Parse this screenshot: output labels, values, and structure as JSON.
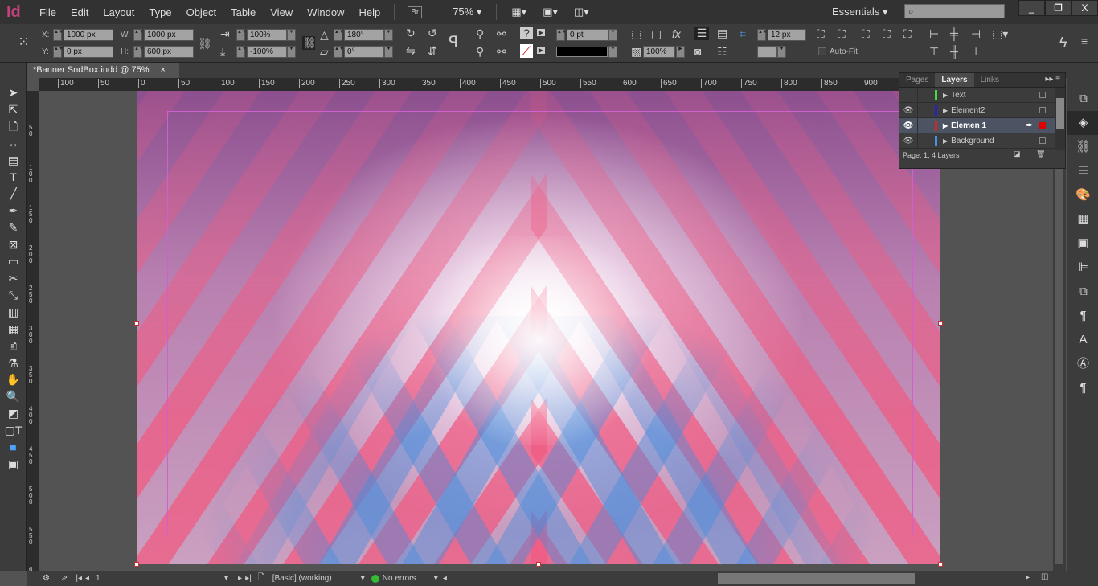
{
  "app": {
    "logo": "Id",
    "menus": [
      "File",
      "Edit",
      "Layout",
      "Type",
      "Object",
      "Table",
      "View",
      "Window",
      "Help"
    ],
    "bridge": "Br",
    "zoom": "75%",
    "workspace": "Essentials",
    "search_placeholder": "",
    "window_controls": [
      "_",
      "❐",
      "X"
    ]
  },
  "control": {
    "x": "1000 px",
    "y": "0 px",
    "w": "1000 px",
    "h": "600 px",
    "x_label": "X:",
    "y_label": "Y:",
    "w_label": "W:",
    "h_label": "H:",
    "scale_x": "100%",
    "scale_y": "-100%",
    "rotate": "180°",
    "shear": "0°",
    "stroke_weight": "0 pt",
    "opacity": "100%",
    "gap": "12 px",
    "autofit": "Auto-Fit",
    "stroke_color": "#000000"
  },
  "document": {
    "tab": "*Banner SndBox.indd @ 75%",
    "close": "×"
  },
  "rulers": {
    "h": [
      "100",
      "50",
      "0",
      "50",
      "100",
      "150",
      "200",
      "250",
      "300",
      "350",
      "400",
      "450",
      "500",
      "550",
      "600",
      "650",
      "700",
      "750",
      "800",
      "850",
      "900"
    ],
    "v": [
      "5 0",
      "1 0 0",
      "1 5 0",
      "2 0 0",
      "2 5 0",
      "3 0 0",
      "3 5 0",
      "4 0 0",
      "4 5 0",
      "5 0 0",
      "5 5 0",
      "6"
    ]
  },
  "layers_panel": {
    "tabs": [
      "Pages",
      "Layers",
      "Links"
    ],
    "active_tab": "Layers",
    "layers": [
      {
        "name": "Text",
        "color": "#44dd44",
        "visible": false,
        "selected": false
      },
      {
        "name": "Element2",
        "color": "#2222cc",
        "visible": true,
        "selected": false
      },
      {
        "name": "Elemen 1",
        "color": "#dd2222",
        "visible": true,
        "selected": true
      },
      {
        "name": "Background",
        "color": "#4a90e2",
        "visible": true,
        "selected": false
      }
    ],
    "footer": "Page: 1, 4 Layers"
  },
  "status": {
    "page": "1",
    "style": "[Basic] (working)",
    "preflight": "No errors",
    "preflight_color": "#33bb33"
  },
  "colors": {
    "accent": "#c2417c",
    "margin_guide": "#d060d0"
  }
}
